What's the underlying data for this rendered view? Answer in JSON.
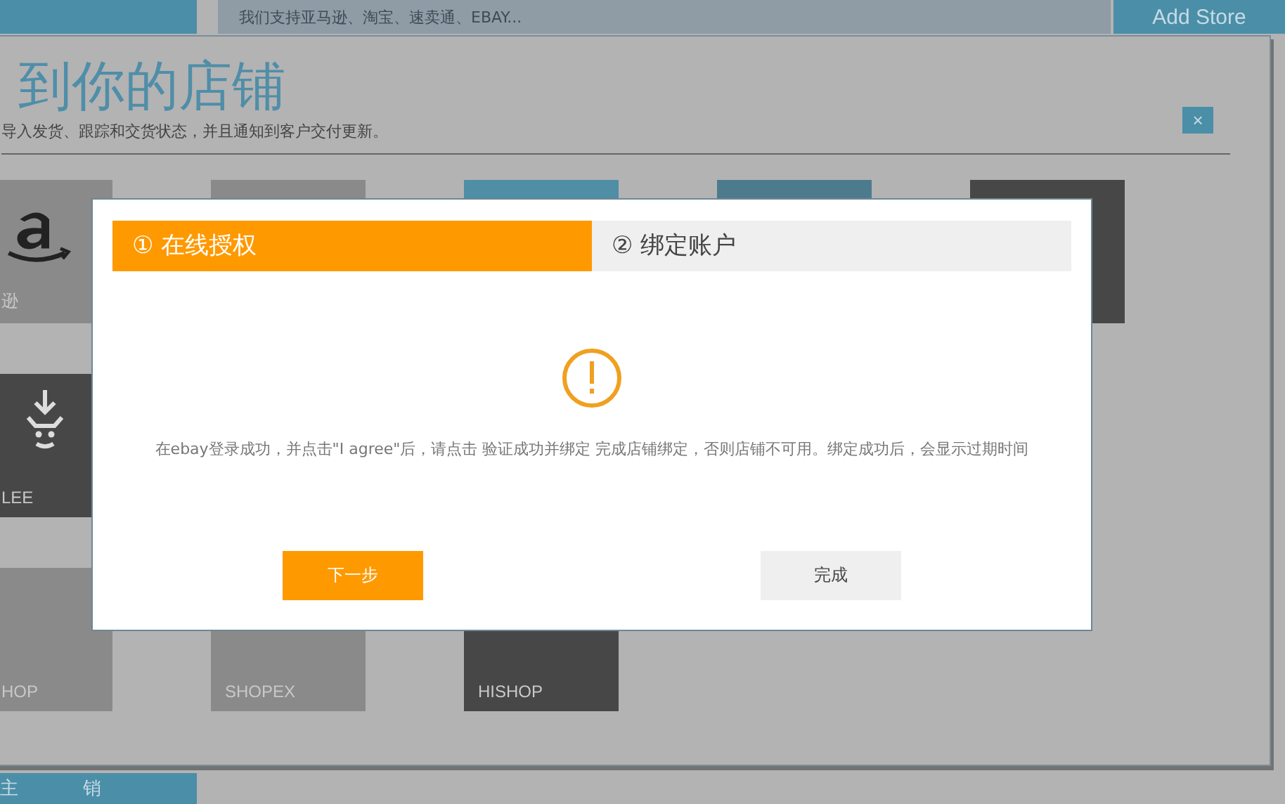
{
  "top_bar": {
    "search_text": "我们支持亚马逊、淘宝、速卖通、EBAY...",
    "add_button": "Add Store"
  },
  "panel": {
    "title": "到你的店铺",
    "subtitle": "导入发货、跟踪和交货状态，并且通知到客户交付更新。",
    "close": "×",
    "rows": [
      [
        {
          "label": "逊",
          "color": "#8a8a8a",
          "kind": "logo"
        },
        {
          "color": "#8a8a8a",
          "kind": "plain"
        },
        {
          "color": "#4f8ea5",
          "kind": "plain"
        },
        {
          "color": "#4d7b8e",
          "kind": "plain"
        },
        {
          "color": "#474747",
          "kind": "plain"
        }
      ],
      [
        {
          "label": "LEE",
          "color": "#474747",
          "kind": "download"
        }
      ],
      [
        {
          "label": "HOP",
          "color": "#8a8a8a",
          "kind": "plain"
        },
        {
          "label": "SHOPEX",
          "color": "#8a8a8a",
          "kind": "plain"
        },
        {
          "label": "HISHOP",
          "color": "#474747",
          "kind": "plain"
        }
      ]
    ]
  },
  "dialog": {
    "steps": [
      {
        "label": "① 在线授权",
        "selected": true
      },
      {
        "label": "② 绑定账户",
        "selected": false
      }
    ],
    "message": "在ebay登录成功，并点击\"I agree\"后，请点击 验证成功并绑定 完成店铺绑定，否则店铺不可用。绑定成功后，会显示过期时间",
    "buttons": [
      {
        "label": "下一步",
        "kind": "primary"
      },
      {
        "label": "完成",
        "kind": "secondary"
      }
    ]
  },
  "bottom_bar": {
    "items": [
      "主",
      "销"
    ]
  }
}
